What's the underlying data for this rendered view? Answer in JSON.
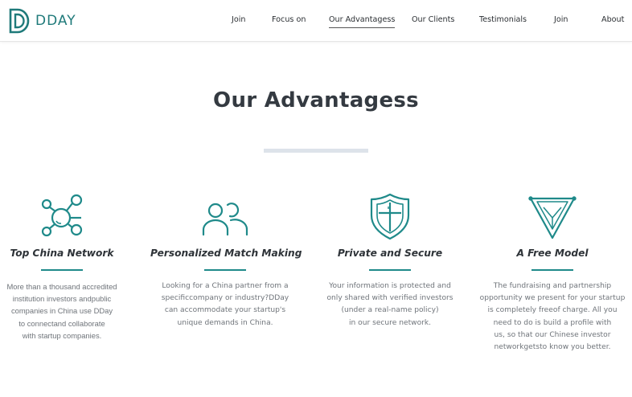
{
  "brand": {
    "name": "DDAY",
    "color": "#1f7a7a"
  },
  "nav": {
    "items": [
      {
        "label": "Join"
      },
      {
        "label": "Focus on"
      },
      {
        "label": "Our Advantagess",
        "active": true
      },
      {
        "label": "Our Clients"
      },
      {
        "label": "Testimonials"
      },
      {
        "label": "Join"
      },
      {
        "label": "About"
      }
    ]
  },
  "section": {
    "title": "Our Advantagess"
  },
  "cards": [
    {
      "icon": "network-icon",
      "title": "Top China Network",
      "lines": [
        "More than a thousand accredited",
        "institution investors andpublic",
        "companies in China use DDay",
        "to connectand collaborate",
        "with startup companies."
      ]
    },
    {
      "icon": "people-icon",
      "title": "Personalized Match Making",
      "lines": [
        "Looking for a China partner from a",
        "specificcompany or industry?DDay",
        "can accommodate your startup's",
        "unique demands in China."
      ]
    },
    {
      "icon": "shield-icon",
      "title": "Private and Secure",
      "lines": [
        "Your information is protected and",
        "only shared with verified investors",
        "(under a real-name policy)",
        "in our secure network."
      ]
    },
    {
      "icon": "triangle-icon",
      "title": "A Free Model",
      "lines": [
        "The fundraising and partnership",
        "opportunity we present for your startup",
        "is completely freeof charge. All you",
        "need to do is build a profile with",
        "us, so that our Chinese investor",
        "networkgetsto know you better."
      ]
    }
  ],
  "colors": {
    "accent": "#1f8a8a",
    "title": "#343a41",
    "body_text": "#6f747a",
    "divider": "#dde3ea"
  }
}
